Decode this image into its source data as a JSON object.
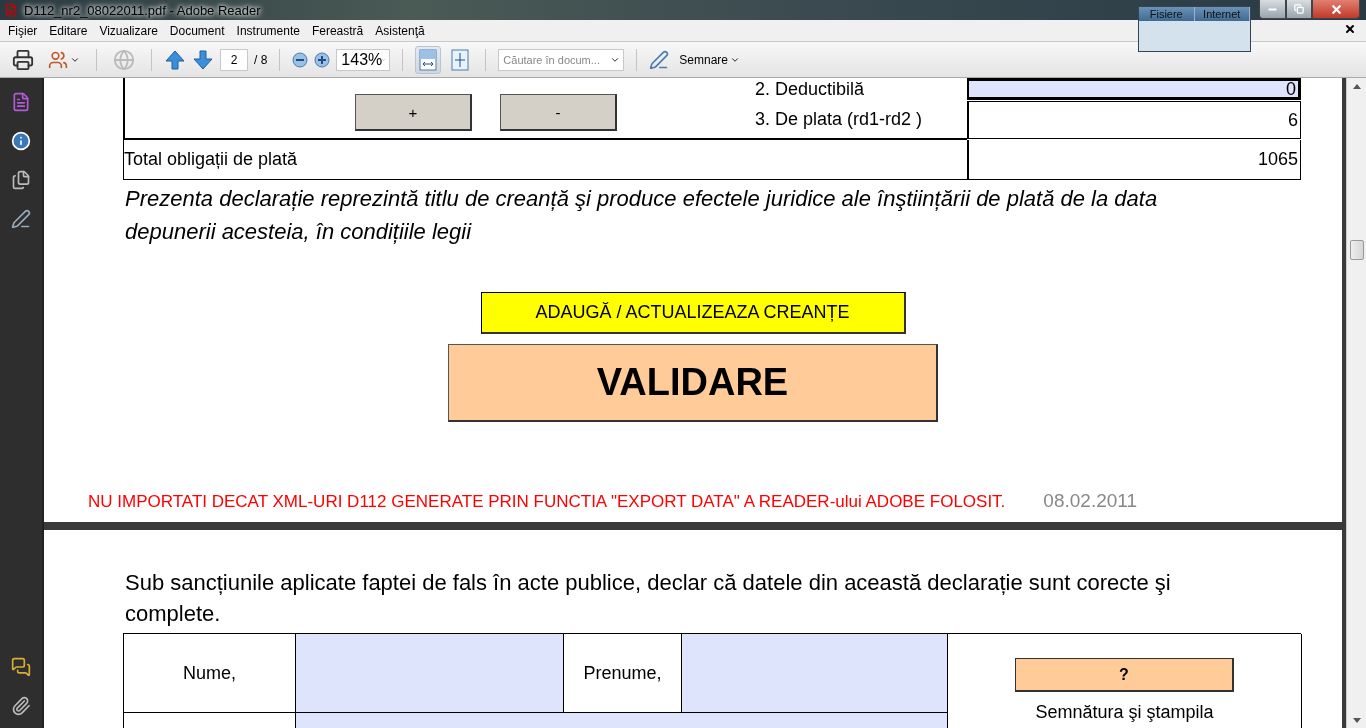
{
  "window": {
    "title": "D112_nr2_08022011.pdf - Adobe Reader"
  },
  "menu": [
    {
      "label": "Fişier"
    },
    {
      "label": "Editare"
    },
    {
      "label": "Vizualizare"
    },
    {
      "label": "Document"
    },
    {
      "label": "Instrumente"
    },
    {
      "label": "Fereastră"
    },
    {
      "label": "Asistenţă"
    }
  ],
  "toolbar": {
    "page": "2",
    "page_total": "/ 8",
    "zoom": "143%",
    "search_placeholder": "Căutare în docum...",
    "sign_label": "Semnare",
    "fit_width_selected": true
  },
  "floating_panel": {
    "tabs": [
      {
        "label": "Fisiere"
      },
      {
        "label": "Internet"
      }
    ]
  },
  "page_1": {
    "buttons": [
      "+",
      "-"
    ],
    "rows": [
      {
        "label": "2. Deductibilă",
        "value": "0",
        "kind": "field"
      },
      {
        "label": "3. De plata (rd1-rd2 )",
        "value": "6",
        "kind": "cell"
      }
    ],
    "total": {
      "label": "Total obligații de plată",
      "value": "1065"
    },
    "note": "Prezenta declarație reprezintă titlu de creanță şi produce efectele juridice ale înştiințării de plată de la data depunerii acesteia, în condițiile legii",
    "update_button": "ADAUGĂ / ACTUALIZEAZA CREANȚE",
    "validate_button": "VALIDARE",
    "warning": "NU IMPORTATI DECAT XML-URI D112 GENERATE PRIN FUNCTIA \"EXPORT DATA\" A READER-ului ADOBE FOLOSIT.",
    "date": "08.02.2011"
  },
  "page_2": {
    "statement": "Sub sancțiunile aplicate faptei de fals în acte publice, declar că datele din această declarație sunt corecte şi complete.",
    "name_label": "Nume,",
    "first_name_label": "Prenume,",
    "help_button": "?",
    "signature_label": "Semnătura şi ştampila"
  }
}
